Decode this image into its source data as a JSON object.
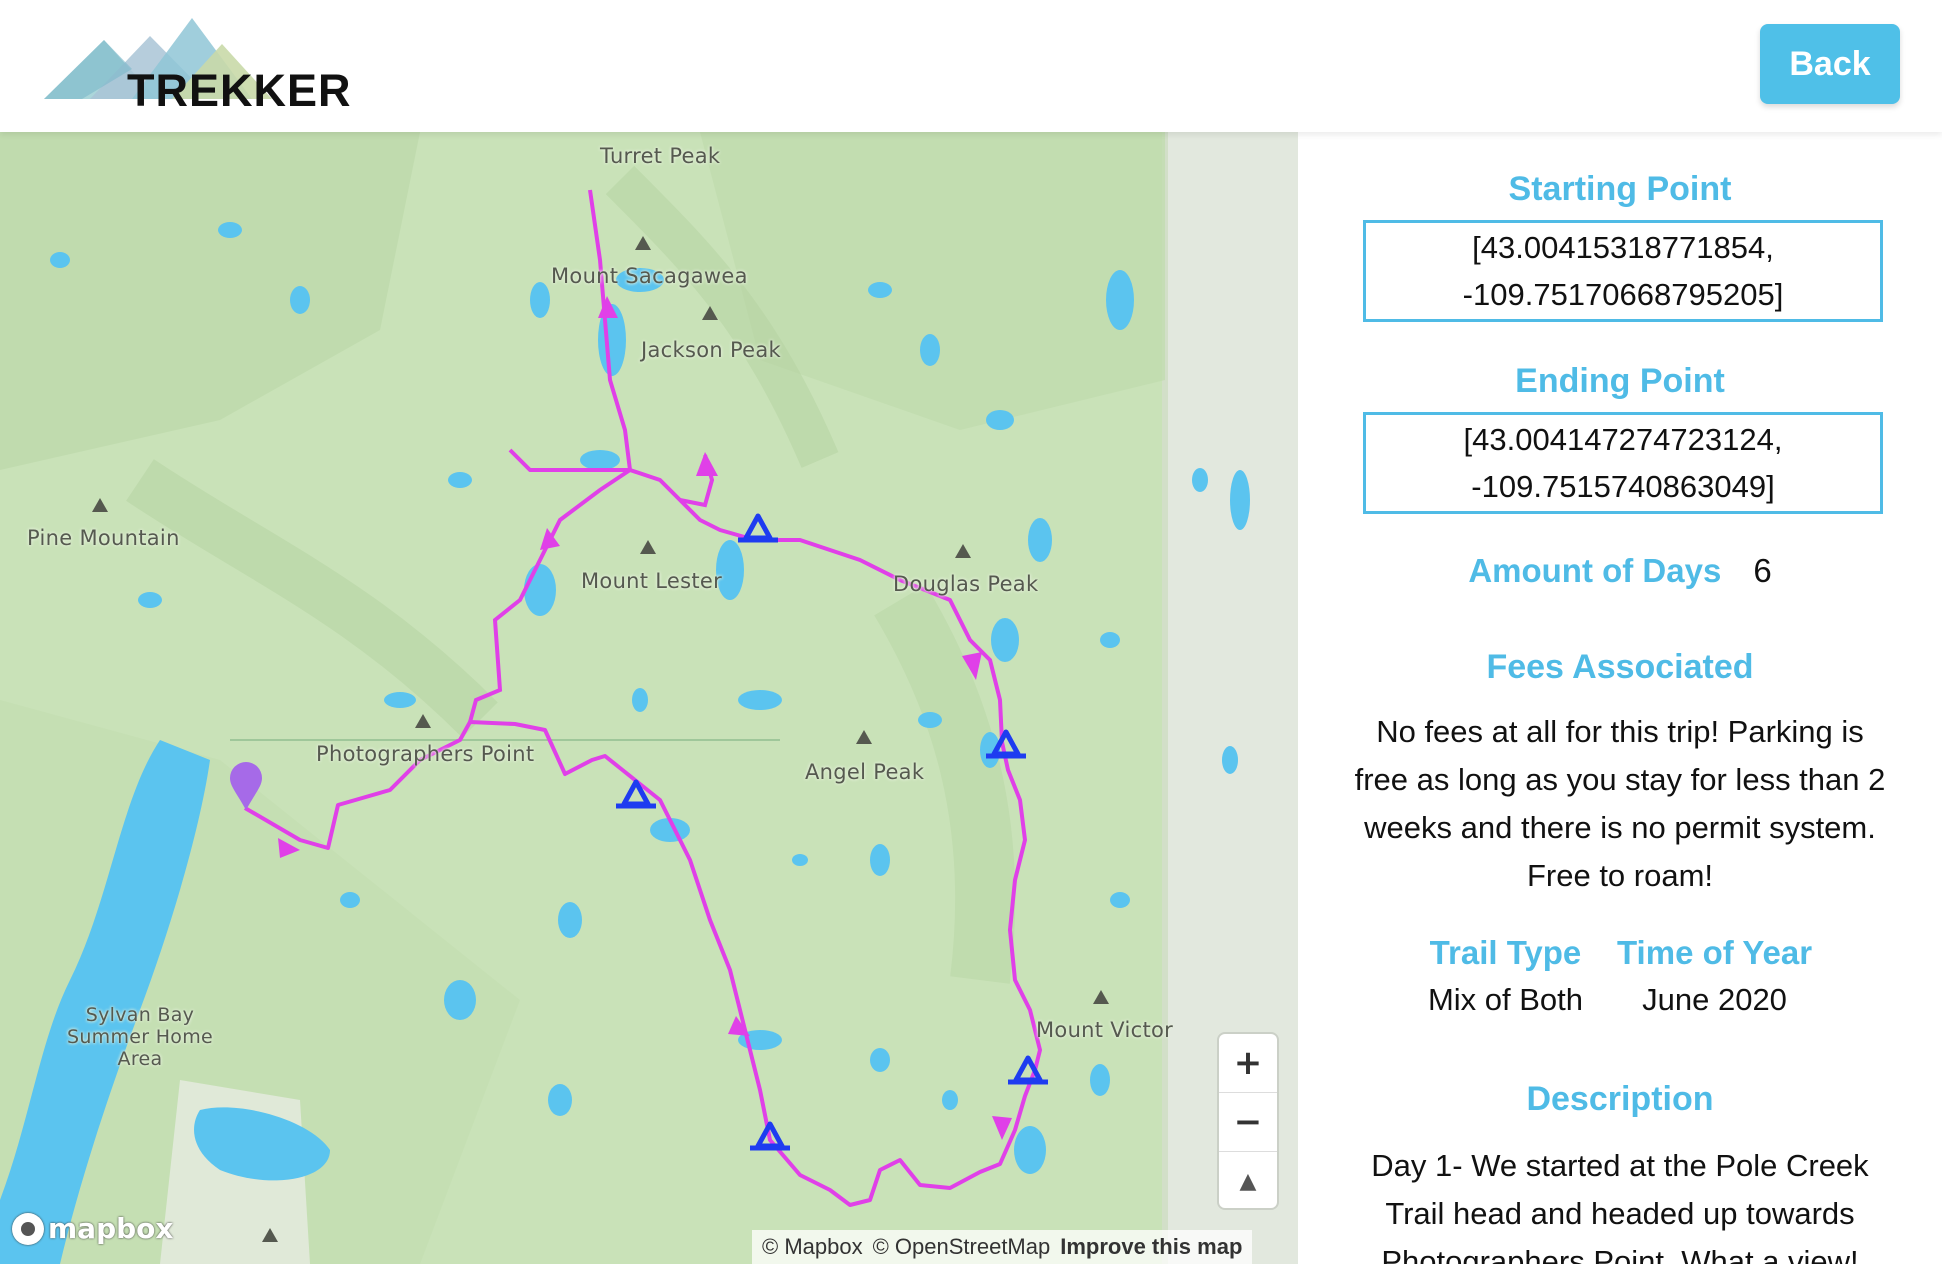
{
  "header": {
    "logo_text": "TREKKER",
    "back_label": "Back"
  },
  "colors": {
    "accent": "#4fbbe6",
    "route": "#e040e8",
    "camp": "#1e3cf0",
    "water": "#5bc4ef",
    "terrain": "#c9e2b8"
  },
  "map": {
    "labels": {
      "turret_peak": "Turret Peak",
      "mount_sacagawea": "Mount Sacagawea",
      "jackson_peak": "Jackson Peak",
      "pine_mountain": "Pine Mountain",
      "mount_lester": "Mount Lester",
      "douglas_peak": "Douglas Peak",
      "photographers_point": "Photographers Point",
      "angel_peak": "Angel Peak",
      "sylvan_bay": "Sylvan Bay Summer Home Area",
      "mount_victor": "Mount Victor"
    },
    "zoom_in": "+",
    "zoom_out": "−",
    "compass": "▲",
    "logo": "mapbox",
    "attribution": {
      "mapbox": "© Mapbox",
      "osm": "© OpenStreetMap",
      "improve": "Improve this map"
    },
    "icons": [
      "mountain-peak-icon",
      "campsite-icon",
      "start-marker-icon",
      "route-arrow-icon"
    ]
  },
  "trip": {
    "starting_point": {
      "label": "Starting Point",
      "line1": "[43.00415318771854,",
      "line2": "-109.75170668795205]"
    },
    "ending_point": {
      "label": "Ending Point",
      "line1": "[43.004147274723124,",
      "line2": "-109.7515740863049]"
    },
    "days": {
      "label": "Amount of Days",
      "value": "6"
    },
    "fees": {
      "label": "Fees Associated",
      "text": "No fees at all for this trip! Parking is free as long as you stay for less than 2 weeks and there is no permit system. Free to roam!"
    },
    "trail_type": {
      "label": "Trail Type",
      "value": "Mix of Both"
    },
    "time_of_year": {
      "label": "Time of Year",
      "value": "June 2020"
    },
    "description": {
      "label": "Description",
      "text": "Day 1- We started at the Pole Creek Trail head and headed up towards Photographers Point. What a view!"
    }
  }
}
